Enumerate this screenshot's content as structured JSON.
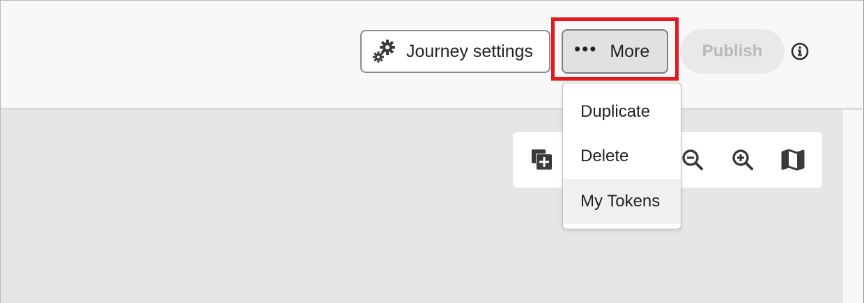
{
  "header": {
    "journey_settings_label": "Journey settings",
    "more_label": "More",
    "more_dots": "•••",
    "publish_label": "Publish"
  },
  "more_menu": {
    "items": [
      {
        "label": "Duplicate"
      },
      {
        "label": "Delete"
      },
      {
        "label": "My Tokens",
        "state": "hovered"
      }
    ]
  },
  "canvas_toolbar": {
    "icons": [
      "add-duplicate-icon",
      "zoom-out-icon",
      "zoom-in-icon",
      "map-icon"
    ]
  },
  "colors": {
    "highlight": "#e3191f",
    "publish_disabled_text": "#b9b9b9",
    "canvas_bg": "#e6e6e6"
  }
}
